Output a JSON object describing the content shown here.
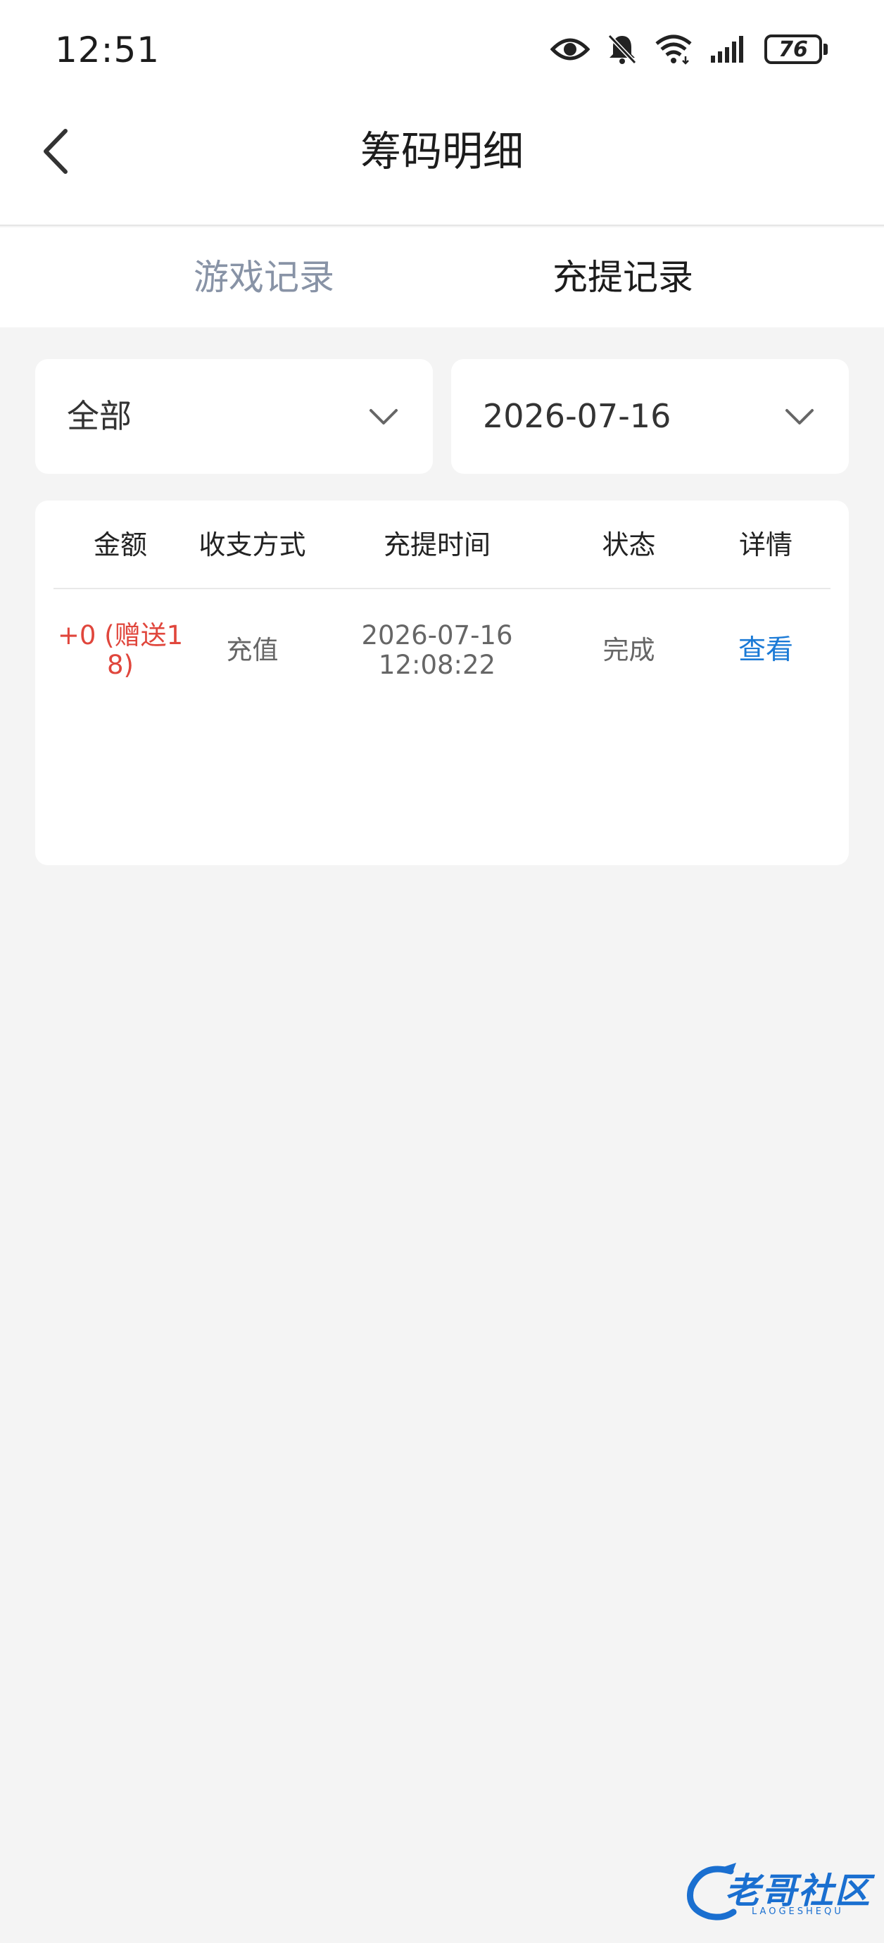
{
  "status_bar": {
    "time": "12:51",
    "battery_level": "76",
    "icons": [
      "eye-icon",
      "bell-muted-icon",
      "wifi-icon",
      "signal-icon",
      "battery-icon"
    ]
  },
  "header": {
    "title": "筹码明细",
    "back_icon": "chevron-left-icon"
  },
  "tabs": [
    {
      "label": "游戏记录",
      "active": false
    },
    {
      "label": "充提记录",
      "active": true
    }
  ],
  "filters": {
    "type_value": "全部",
    "date_value": "2026-07-16"
  },
  "table": {
    "columns": [
      "金额",
      "收支方式",
      "充提时间",
      "状态",
      "详情"
    ],
    "rows": [
      {
        "amount": "+0 (赠送18)",
        "amount_line1": "+0 (赠送1",
        "amount_line2": "8)",
        "method": "充值",
        "date": "2026-07-16",
        "time": "12:08:22",
        "status": "完成",
        "detail_link": "查看"
      }
    ]
  },
  "watermark": {
    "text": "老哥社区",
    "subtext": "LAOGESHEQU"
  },
  "colors": {
    "amount_red": "#e0463c",
    "link_blue": "#1b7ad6",
    "tab_inactive": "#8893a6",
    "background": "#f4f4f4"
  }
}
